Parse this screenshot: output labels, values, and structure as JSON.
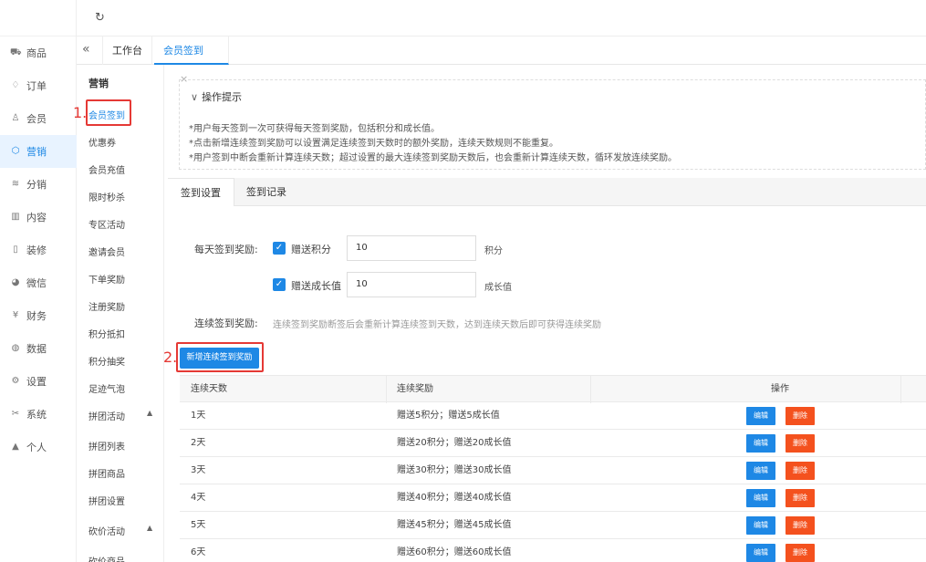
{
  "nav": {
    "items": [
      {
        "label": "商品",
        "icon": "cart-icon",
        "glyph": "⛟"
      },
      {
        "label": "订单",
        "icon": "bell-icon",
        "glyph": "♢"
      },
      {
        "label": "会员",
        "icon": "user-icon",
        "glyph": "♙"
      },
      {
        "label": "营销",
        "icon": "cube-icon",
        "glyph": "⬡"
      },
      {
        "label": "分销",
        "icon": "layers-icon",
        "glyph": "≋"
      },
      {
        "label": "内容",
        "icon": "book-icon",
        "glyph": "▥"
      },
      {
        "label": "装修",
        "icon": "phone-icon",
        "glyph": "▯"
      },
      {
        "label": "微信",
        "icon": "wechat-icon",
        "glyph": "◕"
      },
      {
        "label": "财务",
        "icon": "yen-icon",
        "glyph": "¥"
      },
      {
        "label": "数据",
        "icon": "globe-icon",
        "glyph": "◍"
      },
      {
        "label": "设置",
        "icon": "gear-icon",
        "glyph": "⚙"
      },
      {
        "label": "系统",
        "icon": "tools-icon",
        "glyph": "✂"
      },
      {
        "label": "个人",
        "icon": "person-icon",
        "glyph": "▲"
      }
    ]
  },
  "tabs": {
    "home": "工作台",
    "current": "会员签到",
    "close": "×",
    "collapse": "«",
    "refresh": "↻"
  },
  "subnav": {
    "title": "营销",
    "items": [
      {
        "label": "会员签到"
      },
      {
        "label": "优惠券"
      },
      {
        "label": "会员充值"
      },
      {
        "label": "限时秒杀"
      },
      {
        "label": "专区活动"
      },
      {
        "label": "邀请会员"
      },
      {
        "label": "下单奖励"
      },
      {
        "label": "注册奖励"
      },
      {
        "label": "积分抵扣"
      },
      {
        "label": "积分抽奖"
      },
      {
        "label": "足迹气泡"
      },
      {
        "label": "拼团活动",
        "caret": "▲"
      },
      {
        "label": "拼团列表"
      },
      {
        "label": "拼团商品"
      },
      {
        "label": "拼团设置"
      },
      {
        "label": "砍价活动",
        "caret": "▲"
      },
      {
        "label": "砍价商品"
      }
    ]
  },
  "markers": {
    "one": "1.",
    "two": "2."
  },
  "tip": {
    "title": "操作提示",
    "lines": [
      "*用户每天签到一次可获得每天签到奖励，包括积分和成长值。",
      "*点击新增连续签到奖励可以设置满足连续签到天数时的额外奖励，连续天数规则不能重复。",
      "*用户签到中断会重新计算连续天数；超过设置的最大连续签到奖励天数后，也会重新计算连续天数，循环发放连续奖励。"
    ]
  },
  "content_tabs": {
    "settings": "签到设置",
    "records": "签到记录"
  },
  "form": {
    "daily_label": "每天签到奖励:",
    "points_check": "赠送积分",
    "points_value": "10",
    "points_unit": "积分",
    "growth_check": "赠送成长值",
    "growth_value": "10",
    "growth_unit": "成长值",
    "continuous_label": "连续签到奖励:",
    "continuous_hint": "连续签到奖励断签后会重新计算连续签到天数，达到连续天数后即可获得连续奖励",
    "add_button": "新增连续签到奖励"
  },
  "table": {
    "headers": [
      "连续天数",
      "连续奖励",
      "操作"
    ],
    "edit_label": "编辑",
    "delete_label": "删除",
    "rows": [
      {
        "days": "1天",
        "reward": "赠送5积分；赠送5成长值"
      },
      {
        "days": "2天",
        "reward": "赠送20积分；赠送20成长值"
      },
      {
        "days": "3天",
        "reward": "赠送30积分；赠送30成长值"
      },
      {
        "days": "4天",
        "reward": "赠送40积分；赠送40成长值"
      },
      {
        "days": "5天",
        "reward": "赠送45积分；赠送45成长值"
      },
      {
        "days": "6天",
        "reward": "赠送60积分；赠送60成长值"
      }
    ]
  },
  "colors": {
    "accent": "#1e88e5",
    "danger": "#f4511e",
    "marker": "#e53935"
  }
}
